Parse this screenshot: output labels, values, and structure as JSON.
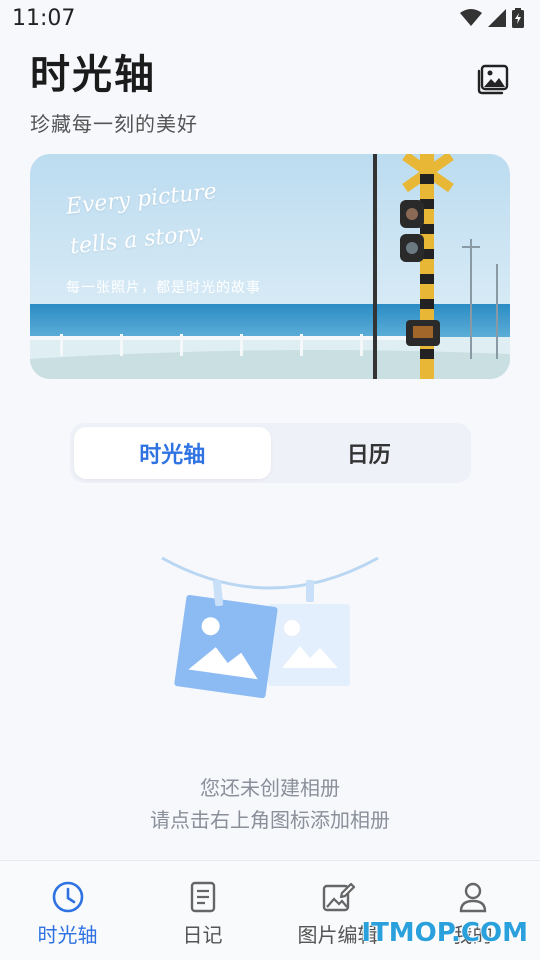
{
  "status_bar": {
    "time": "11:07"
  },
  "header": {
    "title": "时光轴",
    "subtitle": "珍藏每一刻的美好"
  },
  "banner": {
    "script_line1": "Every picture",
    "script_line2": "tells a story.",
    "caption": "每一张照片，都是时光的故事"
  },
  "segment": {
    "tabs": [
      {
        "label": "时光轴"
      },
      {
        "label": "日历"
      }
    ]
  },
  "empty_state": {
    "line1": "您还未创建相册",
    "line2": "请点击右上角图标添加相册"
  },
  "bottom_nav": {
    "items": [
      {
        "label": "时光轴",
        "icon": "clock-icon"
      },
      {
        "label": "日记",
        "icon": "diary-icon"
      },
      {
        "label": "图片编辑",
        "icon": "image-edit-icon"
      },
      {
        "label": "我的",
        "icon": "user-icon"
      }
    ]
  },
  "watermark": "ITMOP.COM",
  "colors": {
    "accent": "#2f73e3",
    "background": "#f6f8fc"
  }
}
